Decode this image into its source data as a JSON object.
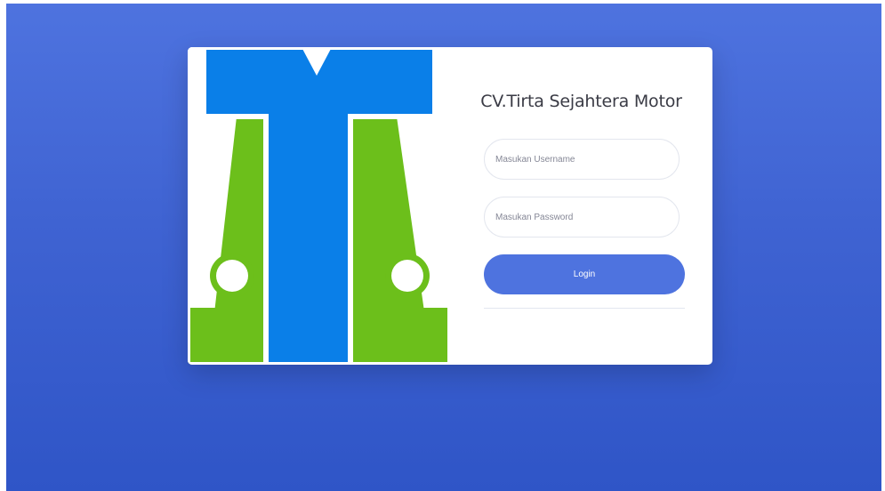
{
  "brand": {
    "title": "CV.Tirta Sejahtera Motor"
  },
  "login_form": {
    "username_placeholder": "Masukan Username",
    "password_placeholder": "Masukan Password",
    "login_label": "Login"
  },
  "logo": {
    "name": "company-logo",
    "colors": {
      "blue": "#0a7fe8",
      "green": "#6cbf1b",
      "outline": "#ffffff"
    }
  },
  "colors": {
    "background_top": "#4e73df",
    "background_bottom": "#2f55c7",
    "accent": "#4e73df",
    "card": "#ffffff"
  }
}
